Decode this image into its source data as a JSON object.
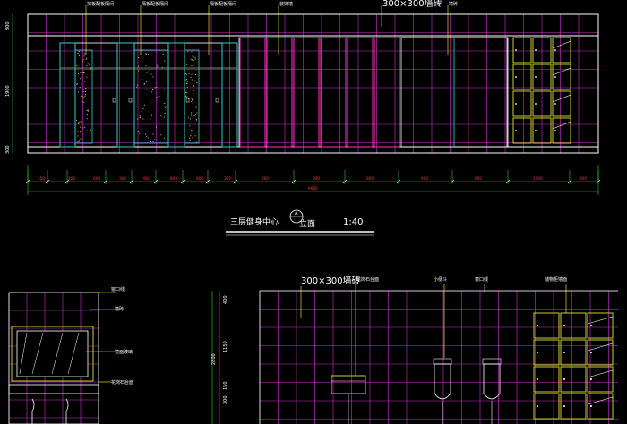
{
  "drawing": {
    "title_cn": "三层健身中心",
    "title_view": "立面",
    "section_mark": "A",
    "scale": "1:40"
  },
  "top_elevation": {
    "labels_top": [
      "挡板配板隔间",
      "隔板配板隔间",
      "隔板配板隔间",
      "装饰墙",
      "300×300墙砖",
      "墙砖"
    ],
    "left_vdims": [
      "800",
      "1900",
      "300"
    ],
    "dims_bottom": [
      "350",
      "300",
      "600",
      "300",
      "900",
      "800",
      "900",
      "300",
      "600",
      "900",
      "900",
      "900",
      "900",
      "1000",
      "300"
    ],
    "total_dim": "9600"
  },
  "bottom_left": {
    "labels": [
      "窗口线",
      "墙砖",
      "镜面玻璃",
      "花岗石台面"
    ]
  },
  "bottom_right": {
    "tile_label": "300×300墙砖",
    "labels": [
      "花岗石台面",
      "小便斗",
      "窗口线",
      "储物柜墙面"
    ],
    "left_vdims": [
      "400",
      "1150",
      "2800",
      "150",
      "300"
    ]
  },
  "colors": {
    "background": "#000000",
    "tile_grid": "#cc33cc",
    "outline": "#ffffff",
    "cubicle": "#33cccc",
    "granite": "#cccc33",
    "locker": "#cccc33",
    "dimension_text": "#ff3333",
    "leader": "#ffff33",
    "green_line": "#33cc33"
  }
}
